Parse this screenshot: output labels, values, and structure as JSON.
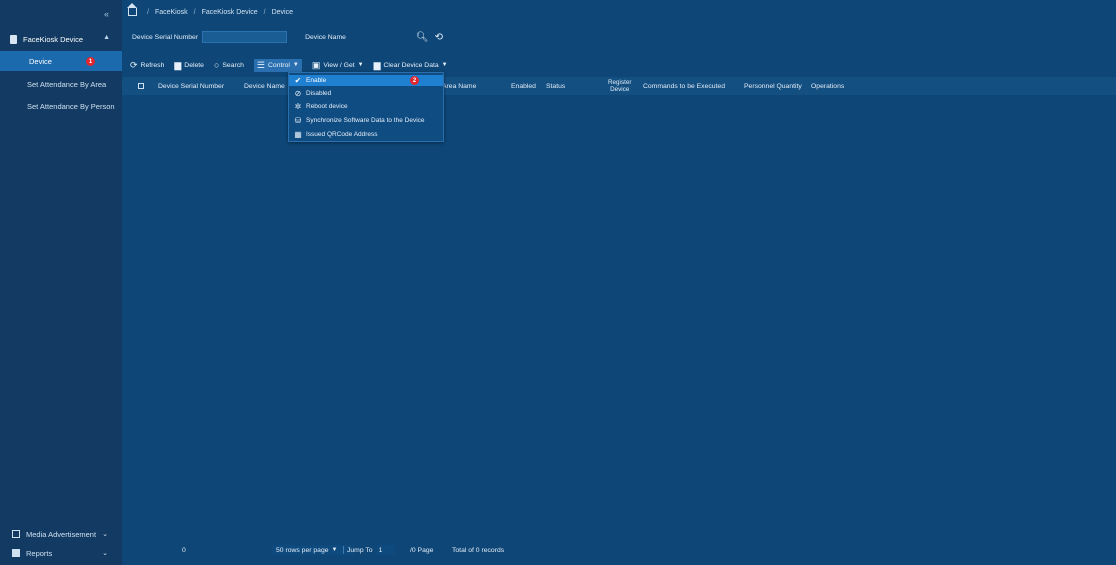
{
  "sidebar": {
    "collapse_icon": "double-chevron-left-icon",
    "group": {
      "label": "FaceKiosk Device",
      "icon": "device-icon"
    },
    "items": [
      {
        "label": "Device",
        "badge": "1",
        "active": true
      },
      {
        "label": "Set Attendance By Area"
      },
      {
        "label": "Set Attendance By Person"
      }
    ],
    "bottom": [
      {
        "label": "Media Advertisement",
        "icon": "media-icon"
      },
      {
        "label": "Reports",
        "icon": "reports-icon"
      }
    ]
  },
  "breadcrumb": [
    "FaceKiosk",
    "FaceKiosk Device",
    "Device"
  ],
  "filters": {
    "serial_label": "Device Serial Number",
    "serial_value": "",
    "name_label": "Device Name",
    "name_value": ""
  },
  "toolbar": {
    "refresh": "Refresh",
    "delete": "Delete",
    "search": "Search",
    "control": "Control",
    "view_get": "View / Get",
    "clear": "Clear Device Data"
  },
  "table": {
    "columns": [
      "Device Serial Number",
      "Device Name",
      "Area Name",
      "Enabled",
      "Status",
      "Register Device",
      "Commands to be Executed",
      "Personnel Quantity",
      "Operations"
    ],
    "register_line1": "Register",
    "register_line2": "Device"
  },
  "control_menu": [
    {
      "label": "Enable",
      "icon": "check-icon",
      "selected": true,
      "badge": "2"
    },
    {
      "label": "Disabled",
      "icon": "ban-icon"
    },
    {
      "label": "Reboot device",
      "icon": "reboot-icon"
    },
    {
      "label": "Synchronize Software Data to the Device",
      "icon": "sync-database-icon"
    },
    {
      "label": "Issued QRCode Address",
      "icon": "qrcode-icon"
    }
  ],
  "pager": {
    "page_number": "0",
    "rows_per_page": "50 rows per page",
    "jump_to_label": "Jump To",
    "jump_to_value": "1",
    "page_of": "/0 Page",
    "total": "Total of 0 records"
  },
  "colors": {
    "background": "#0d4677",
    "sidebar": "#123a62",
    "active": "#1c6aae",
    "badge": "#e0262e",
    "menu_selected": "#1f7fd1"
  }
}
